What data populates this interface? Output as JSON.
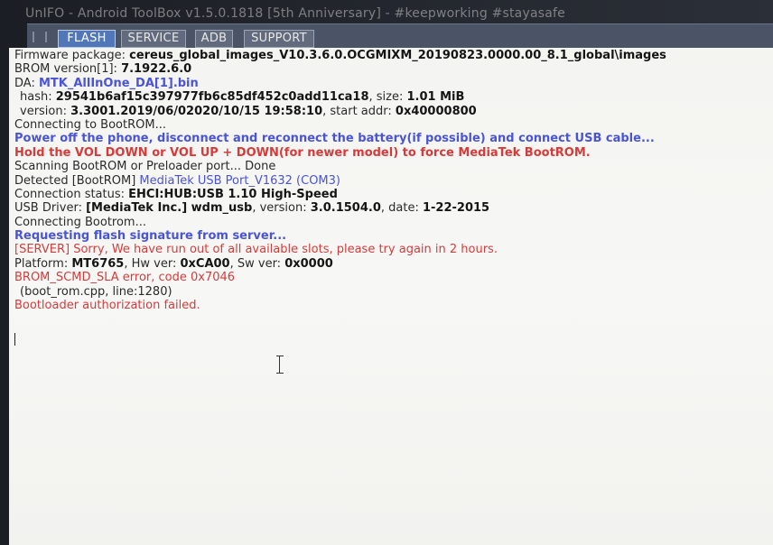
{
  "window": {
    "title": "UnIFO - Android ToolBox v1.5.0.1818 [5th Anniversary] - #keepworking #stayasafe"
  },
  "tabs": [
    {
      "label": "FLASH",
      "active": true
    },
    {
      "label": "SERVICE",
      "active": false
    },
    {
      "label": "ADB",
      "active": false
    },
    {
      "label": "SUPPORT",
      "active": false
    }
  ],
  "log": {
    "firmware_label": "Firmware package: ",
    "firmware_value": "cereus_global_images_V10.3.6.0.OCGMIXM_20190823.0000.00_8.1_global\\images",
    "brom_label": "BROM version[1]: ",
    "brom_value": "7.1922.6.0",
    "da_label": "DA: ",
    "da_value": "MTK_AllInOne_DA[1].bin",
    "hash_label": "hash: ",
    "hash_value": "29541b6af15c397977fb6c85df452c0add11ca18",
    "size_label": ", size: ",
    "size_value": "1.01 MiB",
    "version_label": "version: ",
    "version_value": "3.3001.2019/06/02020/10/15 19:58:10",
    "start_label": ", start addr: ",
    "start_value": "0x40000800",
    "connecting_brom": "Connecting to BootROM...",
    "power_off": "Power off the phone, disconnect and reconnect the battery(if possible) and connect USB cable...",
    "hold_keys": "Hold the VOL DOWN or VOL UP + DOWN(for newer model) to force MediaTek BootROM.",
    "scanning": "Scanning BootROM or Preloader port... Done",
    "detected_label": "Detected [BootROM] ",
    "detected_value": "MediaTek USB Port_V1632 (COM3)",
    "conn_label": "Connection status: ",
    "conn_value": "EHCI:HUB:USB 1.10 High-Speed",
    "usb_label": "USB Driver: ",
    "usb_value": "[MediaTek Inc.] wdm_usb",
    "usb_ver_label": ", version: ",
    "usb_ver_value": "3.0.1504.0",
    "usb_date_label": ", date: ",
    "usb_date_value": "1-22-2015",
    "connecting_bootrom": "Connecting Bootrom...",
    "requesting": "Requesting flash signature from server...",
    "server_error": "[SERVER] Sorry, We have run out of all available slots, please try again in 2 hours.",
    "platform_label": "Platform: ",
    "platform_value": "MT6765",
    "hw_label": ", Hw ver: ",
    "hw_value": "0xCA00",
    "sw_label": ", Sw ver: ",
    "sw_value": "0x0000",
    "sla_error": "BROM_SCMD_SLA error, code 0x7046",
    "boot_rom": "(boot_rom.cpp, line:1280)",
    "bootloader_failed": "Bootloader authorization failed."
  }
}
